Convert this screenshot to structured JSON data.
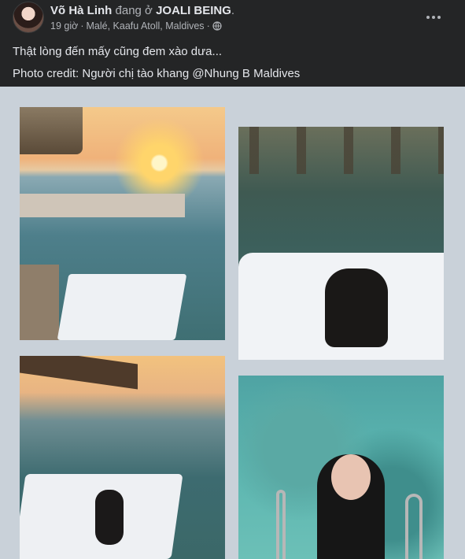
{
  "post": {
    "author": "Võ Hà Linh",
    "checkin_text": "đang ở",
    "location_name": "JOALI BEING",
    "location_suffix": ".",
    "time": "19 giờ",
    "separator": "·",
    "place": "Malé, Kaafu Atoll, Maldives",
    "place_separator": "·",
    "privacy_icon": "globe-icon",
    "more_icon": "more-options-icon",
    "caption_line1": "Thật lòng đến mấy cũng đem xào dưa...",
    "caption_line2": "Photo credit: Người chị tào khang @Nhung B Maldives"
  },
  "collage": {
    "photo_count": 4
  },
  "colors": {
    "background": "#242526",
    "text_primary": "#e4e6eb",
    "text_secondary": "#b0b3b8",
    "collage_background": "#c9d1d9"
  }
}
